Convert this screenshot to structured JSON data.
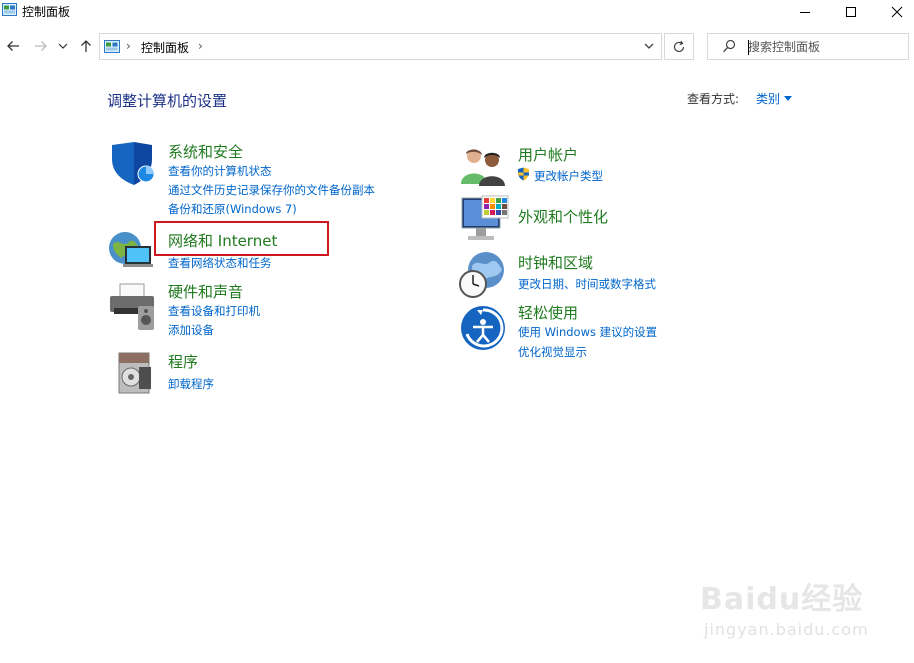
{
  "window": {
    "title": "控制面板"
  },
  "address_bar": {
    "crumb": "控制面板"
  },
  "search": {
    "placeholder": "搜索控制面板"
  },
  "content": {
    "heading": "调整计算机的设置",
    "view_by_label": "查看方式:",
    "view_by_value": "类别"
  },
  "categories": {
    "system_security": {
      "title": "系统和安全",
      "links": [
        "查看你的计算机状态",
        "通过文件历史记录保存你的文件备份副本",
        "备份和还原(Windows 7)"
      ]
    },
    "network": {
      "title": "网络和 Internet",
      "links": [
        "查看网络状态和任务"
      ]
    },
    "hardware": {
      "title": "硬件和声音",
      "links": [
        "查看设备和打印机",
        "添加设备"
      ]
    },
    "programs": {
      "title": "程序",
      "links": [
        "卸载程序"
      ]
    },
    "user_accounts": {
      "title": "用户帐户",
      "links": [
        "更改帐户类型"
      ]
    },
    "appearance": {
      "title": "外观和个性化",
      "links": []
    },
    "clock_region": {
      "title": "时钟和区域",
      "links": [
        "更改日期、时间或数字格式"
      ]
    },
    "ease": {
      "title": "轻松使用",
      "links": [
        "使用 Windows 建议的设置",
        "优化视觉显示"
      ]
    }
  },
  "watermark": {
    "line1": "Baidu经验",
    "line2": "jingyan.baidu.com"
  },
  "colors": {
    "link": "#0066cc",
    "category_title": "#1f7a1f",
    "heading": "#1e3287",
    "highlight": "#d0161f"
  }
}
